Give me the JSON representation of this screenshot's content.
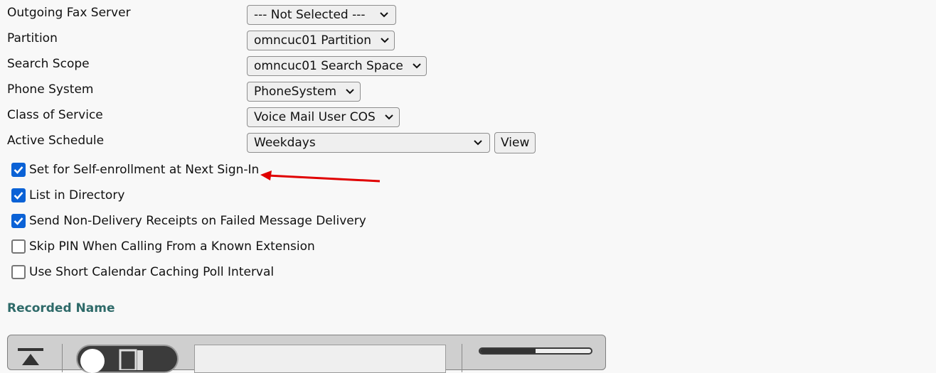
{
  "fields": [
    {
      "label": "Outgoing Fax Server",
      "value": "--- Not Selected ---"
    },
    {
      "label": "Partition",
      "value": "omncuc01 Partition"
    },
    {
      "label": "Search Scope",
      "value": "omncuc01 Search Space"
    },
    {
      "label": "Phone System",
      "value": "PhoneSystem"
    },
    {
      "label": "Class of Service",
      "value": "Voice Mail User COS"
    },
    {
      "label": "Active Schedule",
      "value": "Weekdays"
    }
  ],
  "view_button": "View",
  "checkboxes": [
    {
      "label": "Set for Self-enrollment at Next Sign-In",
      "checked": true
    },
    {
      "label": "List in Directory",
      "checked": true
    },
    {
      "label": "Send Non-Delivery Receipts on Failed Message Delivery",
      "checked": true
    },
    {
      "label": "Skip PIN When Calling From a Known Extension",
      "checked": false
    },
    {
      "label": "Use Short Calendar Caching Poll Interval",
      "checked": false
    }
  ],
  "section": {
    "title": "Recorded Name"
  },
  "player": {
    "progress": 0.5
  },
  "annotation": {
    "arrow_color": "#e00000"
  },
  "colors": {
    "checkbox": "#0b62d6",
    "section_title": "#2e6a69"
  }
}
